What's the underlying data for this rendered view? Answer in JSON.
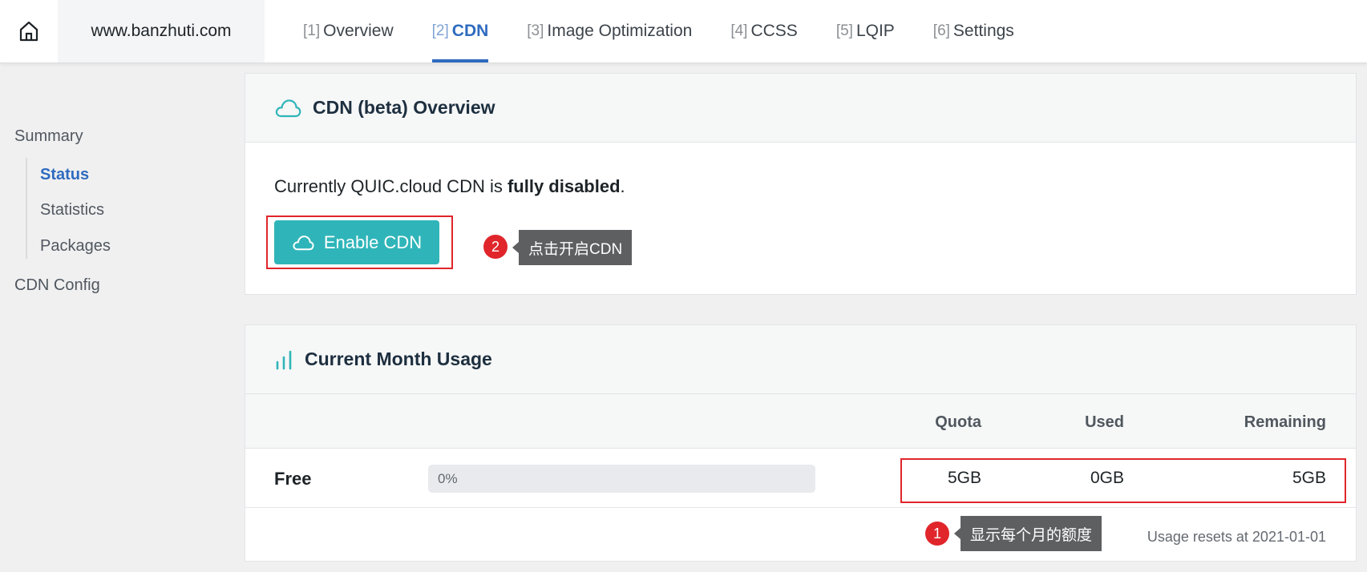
{
  "header": {
    "domain": "www.banzhuti.com",
    "tabs": [
      {
        "num": "[1]",
        "label": "Overview"
      },
      {
        "num": "[2]",
        "label": "CDN"
      },
      {
        "num": "[3]",
        "label": "Image Optimization"
      },
      {
        "num": "[4]",
        "label": "CCSS"
      },
      {
        "num": "[5]",
        "label": "LQIP"
      },
      {
        "num": "[6]",
        "label": "Settings"
      }
    ],
    "active_tab": 1
  },
  "sidebar": {
    "summary": "Summary",
    "items": [
      {
        "label": "Status",
        "active": true
      },
      {
        "label": "Statistics"
      },
      {
        "label": "Packages"
      }
    ],
    "cdn_config": "CDN Config"
  },
  "overview": {
    "title": "CDN (beta) Overview",
    "status_prefix": "Currently QUIC.cloud CDN is ",
    "status_value": "fully disabled",
    "status_suffix": ".",
    "enable_button": "Enable CDN",
    "annotation_number": "2",
    "annotation_text": "点击开启CDN"
  },
  "usage": {
    "title": "Current Month Usage",
    "columns": [
      "Quota",
      "Used",
      "Remaining"
    ],
    "rows": [
      {
        "plan": "Free",
        "progress_label": "0%",
        "progress": 0,
        "quota": "5GB",
        "used": "0GB",
        "remaining": "5GB"
      }
    ],
    "annotation_number": "1",
    "annotation_text": "显示每个月的额度",
    "reset_text": "Usage resets at 2021-01-01"
  },
  "colors": {
    "accent": "#2f6bbf",
    "cdn_button": "#2fb5b9",
    "highlight_box": "#e0262b",
    "tooltip": "#5e5f61"
  }
}
